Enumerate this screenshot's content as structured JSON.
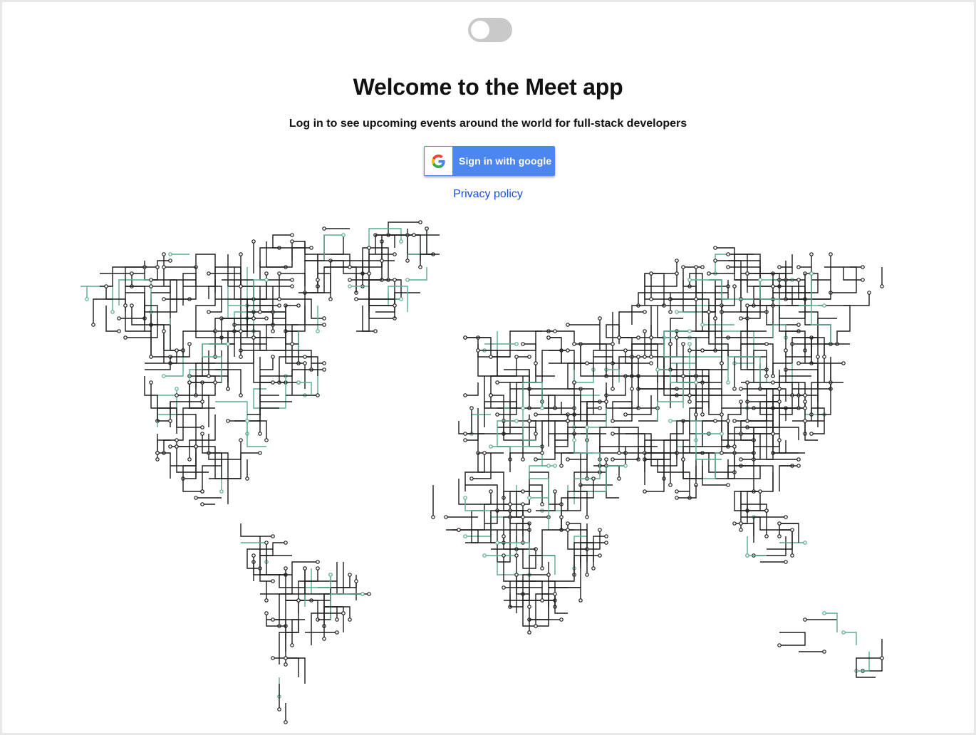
{
  "toggle": {
    "checked": false
  },
  "heading": "Welcome to the Meet app",
  "subheading": "Log in to see upcoming events around the world for full-stack developers",
  "sign_in_button": {
    "label": "Sign in with google",
    "icon": "google-icon"
  },
  "privacy_link": "Privacy policy",
  "map": {
    "icon": "world-map-circuit",
    "colors": {
      "trace": "#1d1d1d",
      "accent": "#5aaa93"
    }
  }
}
